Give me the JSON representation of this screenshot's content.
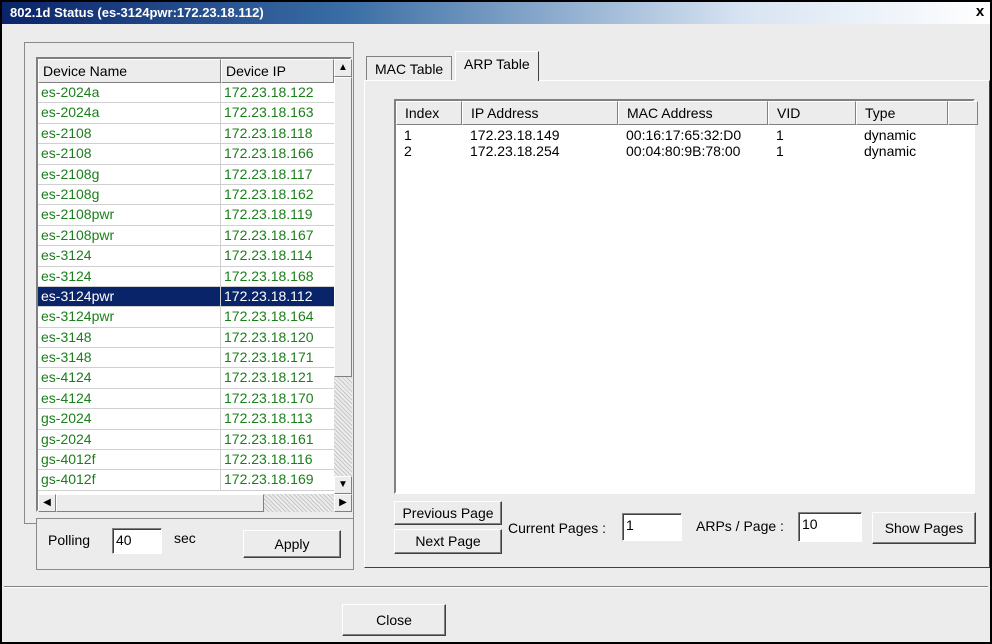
{
  "window": {
    "title": "802.1d Status (es-3124pwr:172.23.18.112)",
    "close_glyph": "x"
  },
  "device_table": {
    "columns": [
      "Device Name",
      "Device IP"
    ],
    "rows": [
      {
        "name": "es-2024a",
        "ip": "172.23.18.122"
      },
      {
        "name": "es-2024a",
        "ip": "172.23.18.163"
      },
      {
        "name": "es-2108",
        "ip": "172.23.18.118"
      },
      {
        "name": "es-2108",
        "ip": "172.23.18.166"
      },
      {
        "name": "es-2108g",
        "ip": "172.23.18.117"
      },
      {
        "name": "es-2108g",
        "ip": "172.23.18.162"
      },
      {
        "name": "es-2108pwr",
        "ip": "172.23.18.119"
      },
      {
        "name": "es-2108pwr",
        "ip": "172.23.18.167"
      },
      {
        "name": "es-3124",
        "ip": "172.23.18.114"
      },
      {
        "name": "es-3124",
        "ip": "172.23.18.168"
      },
      {
        "name": "es-3124pwr",
        "ip": "172.23.18.112",
        "selected": true
      },
      {
        "name": "es-3124pwr",
        "ip": "172.23.18.164"
      },
      {
        "name": "es-3148",
        "ip": "172.23.18.120"
      },
      {
        "name": "es-3148",
        "ip": "172.23.18.171"
      },
      {
        "name": "es-4124",
        "ip": "172.23.18.121"
      },
      {
        "name": "es-4124",
        "ip": "172.23.18.170"
      },
      {
        "name": "gs-2024",
        "ip": "172.23.18.113"
      },
      {
        "name": "gs-2024",
        "ip": "172.23.18.161"
      },
      {
        "name": "gs-4012f",
        "ip": "172.23.18.116"
      },
      {
        "name": "gs-4012f",
        "ip": "172.23.18.169"
      }
    ],
    "text_color": "#1a7f1a",
    "selected_color": "#0a246a"
  },
  "polling": {
    "label": "Polling",
    "value": "40",
    "unit": "sec",
    "apply_label": "Apply"
  },
  "tabs": [
    {
      "label": "MAC Table",
      "active": false
    },
    {
      "label": "ARP Table",
      "active": true
    }
  ],
  "arp_table": {
    "columns": [
      "Index",
      "IP Address",
      "MAC Address",
      "VID",
      "Type"
    ],
    "rows": [
      {
        "index": "1",
        "ip": "172.23.18.149",
        "mac": "00:16:17:65:32:D0",
        "vid": "1",
        "type": "dynamic"
      },
      {
        "index": "2",
        "ip": "172.23.18.254",
        "mac": "00:04:80:9B:78:00",
        "vid": "1",
        "type": "dynamic"
      }
    ]
  },
  "paging": {
    "previous_label": "Previous Page",
    "next_label": "Next Page",
    "current_pages_label": "Current Pages :",
    "current_pages_value": "1",
    "arps_per_page_label": "ARPs / Page :",
    "arps_per_page_value": "10",
    "show_pages_label": "Show Pages"
  },
  "footer": {
    "close_label": "Close"
  },
  "icons": {
    "scroll_up": "▲",
    "scroll_down": "▼",
    "scroll_left": "◀",
    "scroll_right": "▶"
  }
}
